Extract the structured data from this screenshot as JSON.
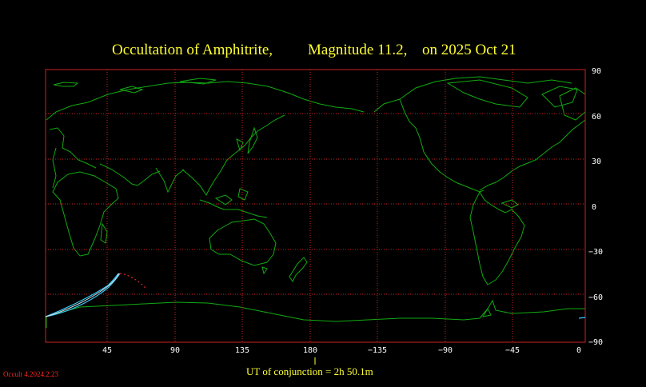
{
  "title": {
    "prefix": "Occultation  of  Amphitrite,",
    "magnitude": "Magnitude 11.2,",
    "date": "on  2025 Oct 21"
  },
  "footer": {
    "conjunction": "UT of conjunction =  2h 50.1m",
    "version": "Occult 4.2024.2.23"
  },
  "axes": {
    "lon_labels": [
      "45",
      "90",
      "135",
      "180",
      "−135",
      "−90",
      "−45",
      "0"
    ],
    "lat_labels": [
      "90",
      "60",
      "30",
      "0",
      "−30",
      "−60",
      "−90"
    ]
  },
  "colors": {
    "background": "#000000",
    "title": "#ffff33",
    "grid": "#cc2222",
    "coastline": "#11aa11",
    "path": "#33ccff",
    "path_end": "#ff3333",
    "footer": "#ffff33",
    "version": "#ff2222",
    "axis_labels": "#ffffff"
  }
}
